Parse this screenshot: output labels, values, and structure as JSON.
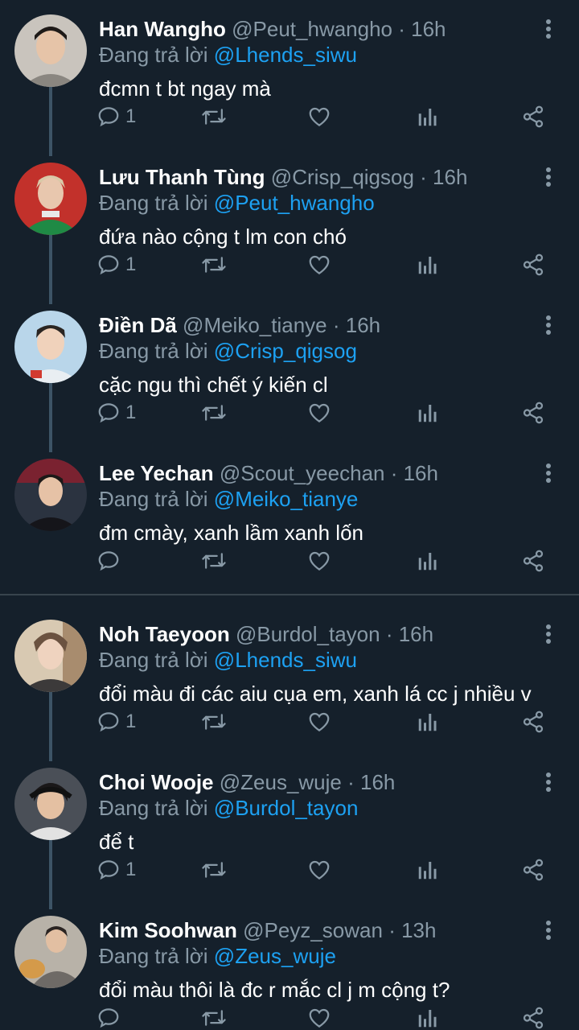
{
  "reply_prefix": "Đang trả lời",
  "icons": {
    "reply": "reply-icon",
    "retweet": "retweet-icon",
    "like": "like-icon",
    "stats": "stats-icon",
    "share": "share-icon",
    "more": "more-icon"
  },
  "colors": {
    "background": "#15202b",
    "secondary_text": "#8899a6",
    "mention": "#1da1f2",
    "thread_line": "#3d5466",
    "divider": "#38444d"
  },
  "tweets": [
    {
      "name": "Han Wangho",
      "handle": "@Peut_hwangho",
      "time": "· 16h",
      "reply_to": "@Lhends_siwu",
      "text": "đcmn t bt ngay mà",
      "reply_count": "1"
    },
    {
      "name": "Lưu Thanh Tùng",
      "handle": "@Crisp_qigsog",
      "time": "· 16h",
      "reply_to": "@Peut_hwangho",
      "text": "đứa nào cộng t lm con chó",
      "reply_count": "1"
    },
    {
      "name": "Điền Dã",
      "handle": "@Meiko_tianye",
      "time": "· 16h",
      "reply_to": "@Crisp_qigsog",
      "text": "cặc ngu thì chết ý kiến cl",
      "reply_count": "1"
    },
    {
      "name": "Lee Yechan",
      "handle": "@Scout_yeechan",
      "time": "· 16h",
      "reply_to": "@Meiko_tianye",
      "text": "đm cmày, xanh lầm xanh lốn",
      "reply_count": ""
    },
    {
      "name": "Noh Taeyoon",
      "handle": "@Burdol_tayon",
      "time": "· 16h",
      "reply_to": "@Lhends_siwu",
      "text": "đổi màu đi các aiu cụa em, xanh lá cc j nhiều v",
      "reply_count": "1"
    },
    {
      "name": "Choi Wooje",
      "handle": "@Zeus_wuje",
      "time": "· 16h",
      "reply_to": "@Burdol_tayon",
      "text": "để t",
      "reply_count": "1"
    },
    {
      "name": "Kim Soohwan",
      "handle": "@Peyz_sowan",
      "time": "· 13h",
      "reply_to": "@Zeus_wuje",
      "text": "đổi màu thôi là đc r mắc cl j m cộng t?",
      "reply_count": ""
    }
  ]
}
